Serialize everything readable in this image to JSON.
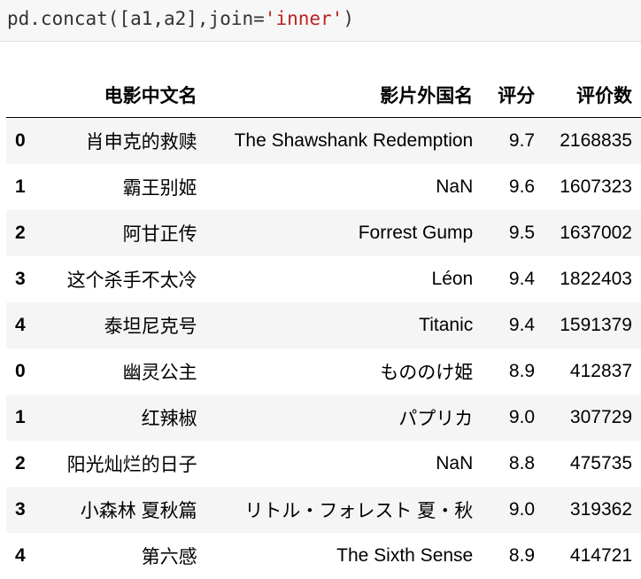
{
  "code": {
    "prefix": "pd.concat([a1,a2],join=",
    "string": "'inner'",
    "suffix": ")"
  },
  "table": {
    "columns": [
      "",
      "电影中文名",
      "影片外国名",
      "评分",
      "评价数"
    ],
    "rows": [
      {
        "index": "0",
        "cn": "肖申克的救赎",
        "en": "The Shawshank Redemption",
        "score": "9.7",
        "votes": "2168835"
      },
      {
        "index": "1",
        "cn": "霸王别姬",
        "en": "NaN",
        "score": "9.6",
        "votes": "1607323"
      },
      {
        "index": "2",
        "cn": "阿甘正传",
        "en": "Forrest Gump",
        "score": "9.5",
        "votes": "1637002"
      },
      {
        "index": "3",
        "cn": "这个杀手不太冷",
        "en": "Léon",
        "score": "9.4",
        "votes": "1822403"
      },
      {
        "index": "4",
        "cn": "泰坦尼克号",
        "en": "Titanic",
        "score": "9.4",
        "votes": "1591379"
      },
      {
        "index": "0",
        "cn": "幽灵公主",
        "en": "もののけ姫",
        "score": "8.9",
        "votes": "412837"
      },
      {
        "index": "1",
        "cn": "红辣椒",
        "en": "パプリカ",
        "score": "9.0",
        "votes": "307729"
      },
      {
        "index": "2",
        "cn": "阳光灿烂的日子",
        "en": "NaN",
        "score": "8.8",
        "votes": "475735"
      },
      {
        "index": "3",
        "cn": "小森林 夏秋篇",
        "en": "リトル・フォレスト 夏・秋",
        "score": "9.0",
        "votes": "319362"
      },
      {
        "index": "4",
        "cn": "第六感",
        "en": "The Sixth Sense",
        "score": "8.9",
        "votes": "414721"
      }
    ]
  }
}
